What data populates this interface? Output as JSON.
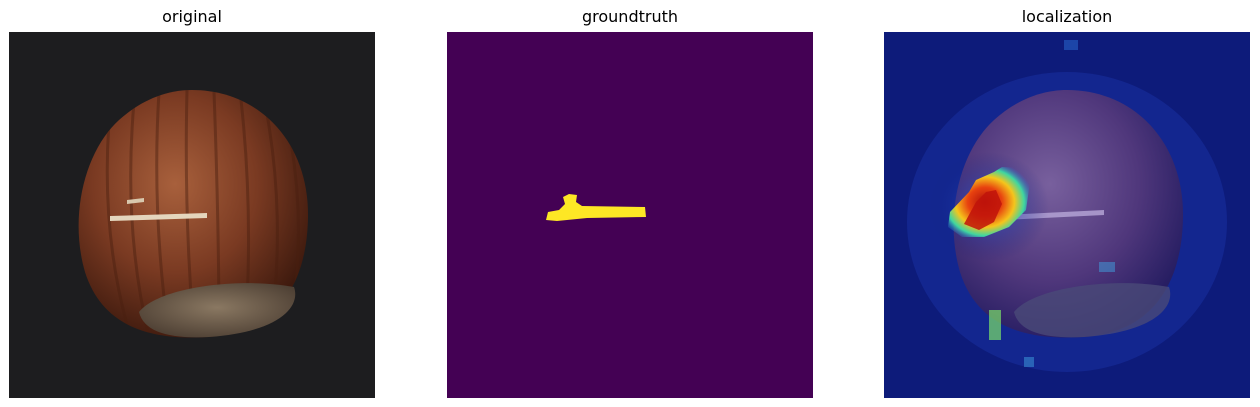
{
  "panels": [
    {
      "title": "original"
    },
    {
      "title": "groundtruth"
    },
    {
      "title": "localization"
    }
  ],
  "colors": {
    "background": "#1d1d1f",
    "nut_shell": "#7a3a22",
    "nut_base": "#6b5a48",
    "scratch": "#e4d6bd",
    "mask_background": "#440154",
    "mask_defect": "#fde725",
    "heatmap_low": "#0d1b7a",
    "heatmap_high": "#d9150b"
  }
}
